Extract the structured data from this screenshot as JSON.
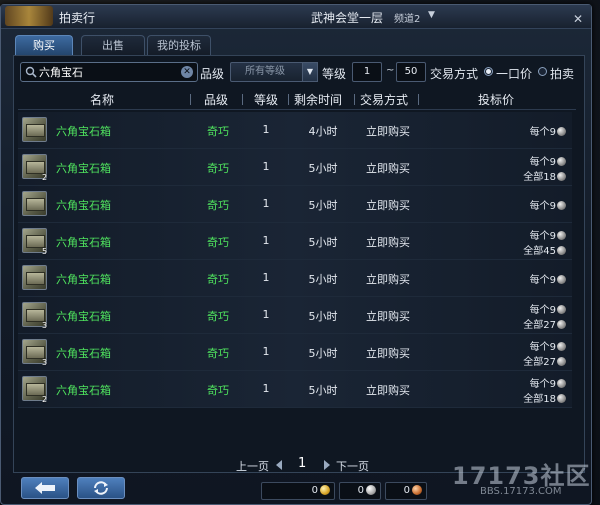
{
  "window": {
    "title": "拍卖行",
    "server": "武神会堂一层",
    "channel": "频道2"
  },
  "tabs": [
    {
      "label": "购买",
      "active": true
    },
    {
      "label": "出售",
      "active": false
    },
    {
      "label": "我的投标",
      "active": false
    }
  ],
  "filters": {
    "search_value": "六角宝石",
    "grade_label": "品级",
    "grade_select": "所有等级",
    "level_label": "等级",
    "level_min": "1",
    "level_sep": "~",
    "level_max": "50",
    "trade_label": "交易方式",
    "option_fixed": "一口价",
    "option_auction": "拍卖",
    "selected_option": "一口价"
  },
  "table": {
    "headers": [
      "名称",
      "品级",
      "等级",
      "剩余时间",
      "交易方式",
      "投标价"
    ],
    "rows": [
      {
        "count": "",
        "name": "六角宝石箱",
        "grade": "奇巧",
        "level": "1",
        "time": "4小时",
        "trade": "立即购买",
        "price_each": "每个9",
        "price_total": ""
      },
      {
        "count": "2",
        "name": "六角宝石箱",
        "grade": "奇巧",
        "level": "1",
        "time": "5小时",
        "trade": "立即购买",
        "price_each": "每个9",
        "price_total": "全部18"
      },
      {
        "count": "",
        "name": "六角宝石箱",
        "grade": "奇巧",
        "level": "1",
        "time": "5小时",
        "trade": "立即购买",
        "price_each": "每个9",
        "price_total": ""
      },
      {
        "count": "5",
        "name": "六角宝石箱",
        "grade": "奇巧",
        "level": "1",
        "time": "5小时",
        "trade": "立即购买",
        "price_each": "每个9",
        "price_total": "全部45"
      },
      {
        "count": "",
        "name": "六角宝石箱",
        "grade": "奇巧",
        "level": "1",
        "time": "5小时",
        "trade": "立即购买",
        "price_each": "每个9",
        "price_total": ""
      },
      {
        "count": "3",
        "name": "六角宝石箱",
        "grade": "奇巧",
        "level": "1",
        "time": "5小时",
        "trade": "立即购买",
        "price_each": "每个9",
        "price_total": "全部27"
      },
      {
        "count": "3",
        "name": "六角宝石箱",
        "grade": "奇巧",
        "level": "1",
        "time": "5小时",
        "trade": "立即购买",
        "price_each": "每个9",
        "price_total": "全部27"
      },
      {
        "count": "2",
        "name": "六角宝石箱",
        "grade": "奇巧",
        "level": "1",
        "time": "5小时",
        "trade": "立即购买",
        "price_each": "每个9",
        "price_total": "全部18"
      }
    ]
  },
  "pager": {
    "prev": "上一页",
    "page": "1",
    "next": "下一页"
  },
  "money": {
    "gold": "0",
    "silver": "0",
    "copper": "0"
  },
  "watermark": {
    "logo": "17173社区",
    "url": "BBS.17173.COM"
  },
  "icons": {
    "back": "arrow-left-icon",
    "refresh": "refresh-icon",
    "search": "search-icon",
    "close": "close-icon"
  }
}
